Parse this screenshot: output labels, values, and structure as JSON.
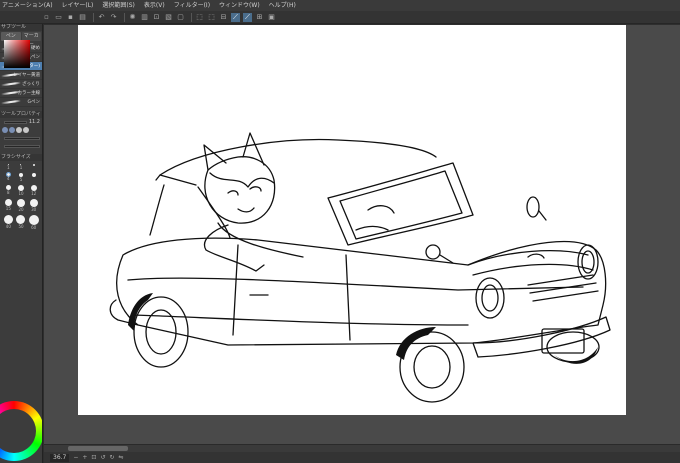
{
  "menubar": {
    "items": [
      "アニメーション(A)",
      "レイヤー(L)",
      "選択範囲(S)",
      "表示(V)",
      "フィルター(I)",
      "ウィンドウ(W)",
      "ヘルプ(H)"
    ]
  },
  "left_panel": {
    "tool_panel_title": "サブツール",
    "tool_tabs": [
      "ペン",
      "マーカー"
    ],
    "brushes": [
      {
        "label": "硬め",
        "selected": false
      },
      {
        "label": "軽ら丸ペン",
        "selected": false
      },
      {
        "label": "ペン(ター)",
        "selected": true
      },
      {
        "label": "レイヤー黄道",
        "selected": false
      },
      {
        "label": "ざっくり",
        "selected": false
      },
      {
        "label": "カラー主線",
        "selected": false
      },
      {
        "label": "Gペン",
        "selected": false
      }
    ],
    "props_title": "ツールプロパティ",
    "prop_value": "11.2",
    "size_panel_title": "ブラシサイズ",
    "sizes": [
      "1",
      "1",
      "",
      "4",
      "5",
      "",
      "8",
      "10",
      "12",
      "15",
      "20",
      "30",
      "40",
      "50",
      "60"
    ]
  },
  "toolbar": {
    "icons": [
      "new-icon",
      "open-icon",
      "save-icon",
      "undo-icon",
      "redo-icon",
      "trash-icon",
      "transform-icon",
      "select-icon",
      "deselect-icon"
    ]
  },
  "statusbar": {
    "zoom": "36.7"
  },
  "colors": {
    "accent": "#4e7fb0",
    "panel": "#3c3c3c",
    "workspace": "#4a4a4a",
    "canvas": "#ffffff"
  }
}
